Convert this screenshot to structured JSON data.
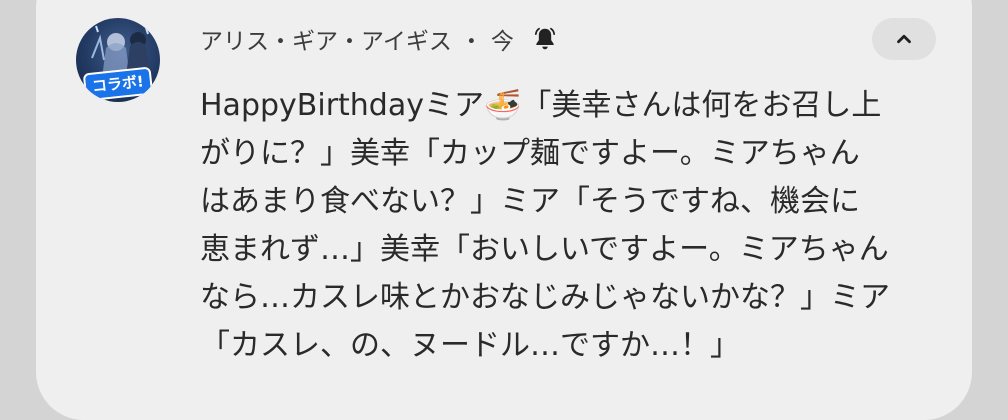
{
  "notification": {
    "app_name": "アリス・ギア・アイギス",
    "separator": "・",
    "time": "今",
    "avatar_badge": "コラボ!",
    "bell_icon": "bell-icon",
    "expand_icon": "chevron-up-icon",
    "message_lines": [
      "HappyBirthdayミア🍜「美幸さんは何をお召し上",
      "がりに？」美幸「カップ麺ですよー。ミアちゃん",
      "はあまり食べない？」ミア「そうですね、機会に",
      "恵まれず…」美幸「おいしいですよー。ミアちゃん",
      "なら…カスレ味とかおなじみじゃないかな？」ミア",
      "「カスレ、の、ヌードル…ですか…！」"
    ]
  },
  "colors": {
    "background": "#d4d4d4",
    "card": "#efefef",
    "button": "#e0e0e0",
    "text": "#2a2a2a",
    "badge": "#1a73e8"
  }
}
